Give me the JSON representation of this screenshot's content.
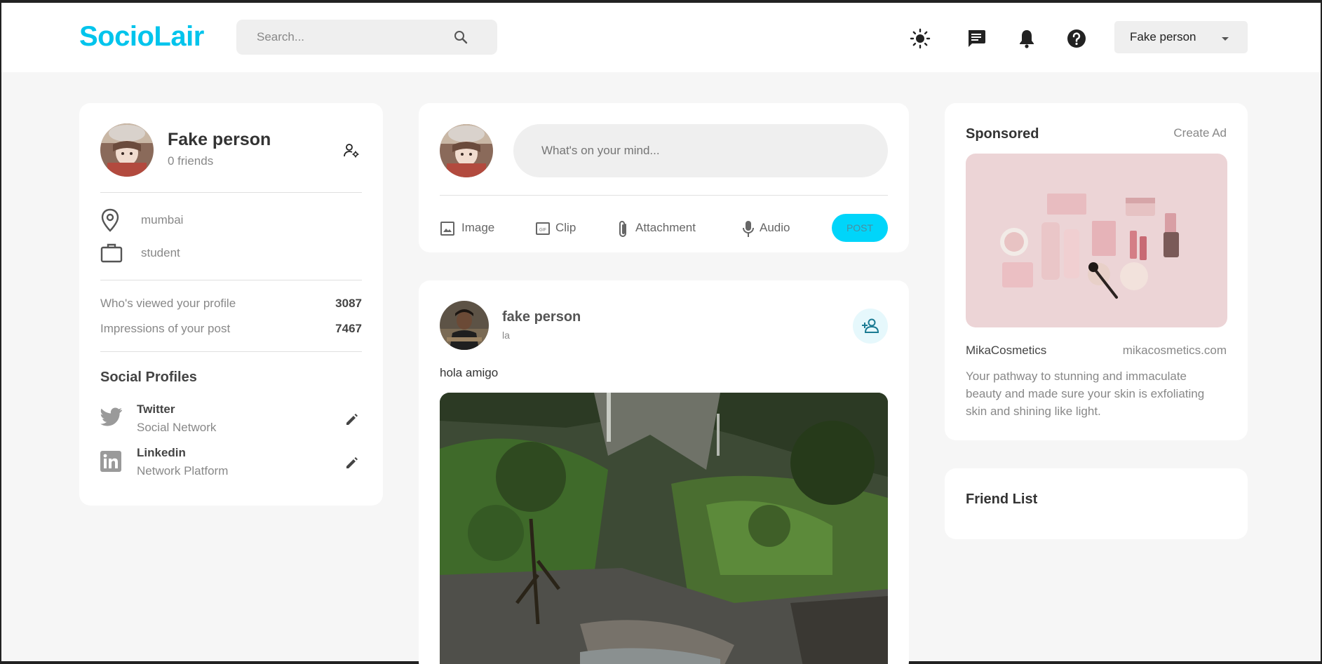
{
  "brand": {
    "logo": "SocioLair",
    "accent": "#00c4ec"
  },
  "nav": {
    "search_placeholder": "Search...",
    "icons": [
      "sun-icon",
      "message-icon",
      "bell-icon",
      "help-icon"
    ],
    "user_name": "Fake person"
  },
  "profile": {
    "name": "Fake person",
    "friends": "0 friends",
    "location": "mumbai",
    "occupation": "student",
    "stats": [
      {
        "label": "Who's viewed your profile",
        "value": "3087"
      },
      {
        "label": "Impressions of your post",
        "value": "7467"
      }
    ],
    "social_title": "Social Profiles",
    "socials": [
      {
        "name": "Twitter",
        "type": "Social Network"
      },
      {
        "name": "Linkedin",
        "type": "Network Platform"
      }
    ]
  },
  "composer": {
    "placeholder": "What's on your mind...",
    "actions": [
      "Image",
      "Clip",
      "Attachment",
      "Audio"
    ],
    "post_label": "POST"
  },
  "post": {
    "author": "fake person",
    "location": "la",
    "text": "hola amigo"
  },
  "sponsored": {
    "title": "Sponsored",
    "create_ad": "Create Ad",
    "brand": "MikaCosmetics",
    "url": "mikacosmetics.com",
    "description_lines": [
      "Your pathway to stunning and immaculate",
      "beauty and made sure your skin is exfoliating",
      "skin and shining like light."
    ]
  },
  "friend_list": {
    "title": "Friend List"
  }
}
